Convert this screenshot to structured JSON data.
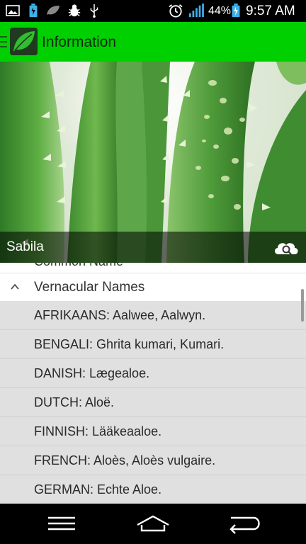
{
  "status_bar": {
    "battery_percent": "44%",
    "time": "9:57 AM"
  },
  "action_bar": {
    "title": "Information"
  },
  "hero": {
    "caption": "Sabila"
  },
  "list": {
    "partial_header": "Common Name",
    "group_title": "Vernacular Names",
    "items": [
      "AFRIKAANS: Aalwee, Aalwyn.",
      "BENGALI: Ghrita kumari, Kumari.",
      "DANISH: Lægealoe.",
      "DUTCH: Aloë.",
      "FINNISH: Lääkeaaloe.",
      "FRENCH: Aloès, Aloès vulgaire.",
      "GERMAN: Echte Aloe."
    ]
  },
  "colors": {
    "action_bar": "#00d000",
    "list_background": "#e0e0e0"
  }
}
